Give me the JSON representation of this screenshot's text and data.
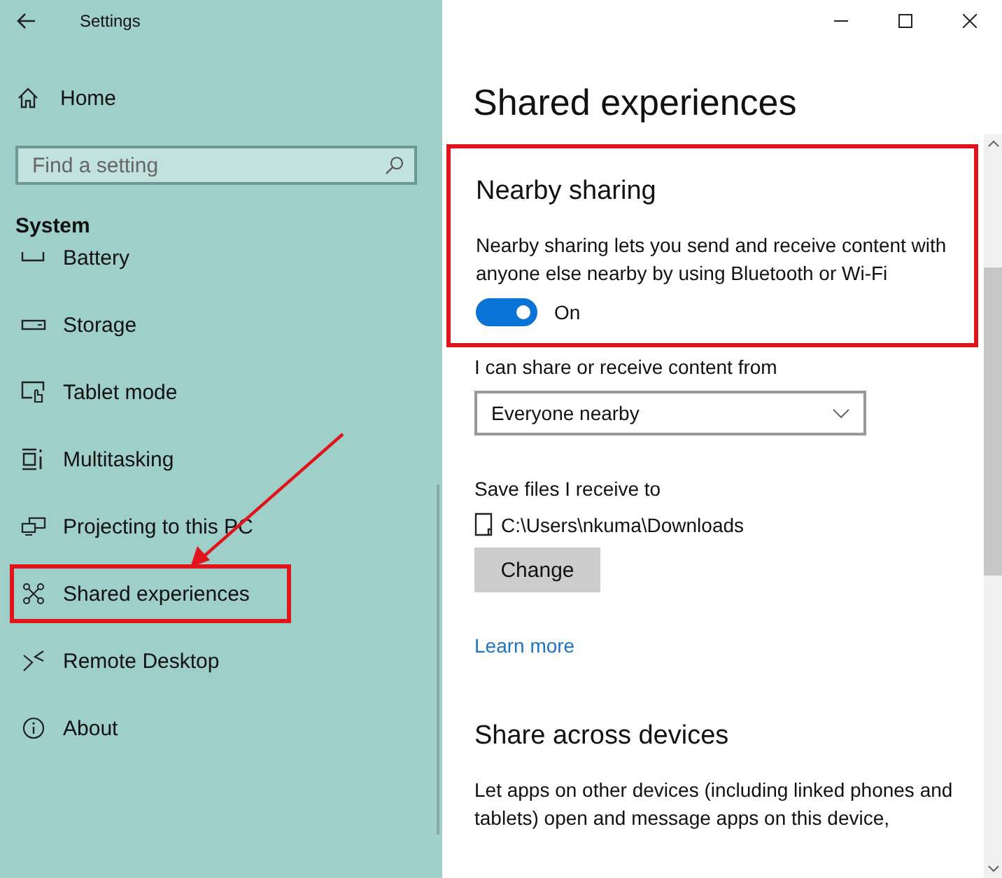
{
  "window": {
    "title": "Settings"
  },
  "sidebar": {
    "home": "Home",
    "search": {
      "placeholder": "Find a setting"
    },
    "section": "System",
    "items": [
      {
        "kind": "battery",
        "label": "Battery",
        "highlighted": false
      },
      {
        "kind": "storage",
        "label": "Storage",
        "highlighted": false
      },
      {
        "kind": "tablet",
        "label": "Tablet mode",
        "highlighted": false
      },
      {
        "kind": "multitask",
        "label": "Multitasking",
        "highlighted": false
      },
      {
        "kind": "project",
        "label": "Projecting to this PC",
        "highlighted": false
      },
      {
        "kind": "shared",
        "label": "Shared experiences",
        "highlighted": true
      },
      {
        "kind": "remote",
        "label": "Remote Desktop",
        "highlighted": false
      },
      {
        "kind": "about",
        "label": "About",
        "highlighted": false
      }
    ]
  },
  "page": {
    "title": "Shared experiences",
    "nearby": {
      "heading": "Nearby sharing",
      "highlighted": true,
      "description": "Nearby sharing lets you send and receive content with anyone else nearby by using Bluetooth or Wi-Fi",
      "toggle": {
        "on": true,
        "label": "On"
      }
    },
    "share_from": {
      "label": "I can share or receive content from",
      "value": "Everyone nearby"
    },
    "save": {
      "label": "Save files I receive to",
      "path": "C:\\Users\\nkuma\\Downloads",
      "button": "Change"
    },
    "link": "Learn more",
    "across": {
      "heading": "Share across devices",
      "description": "Let apps on other devices (including linked phones and tablets) open and message apps on this device,"
    }
  }
}
